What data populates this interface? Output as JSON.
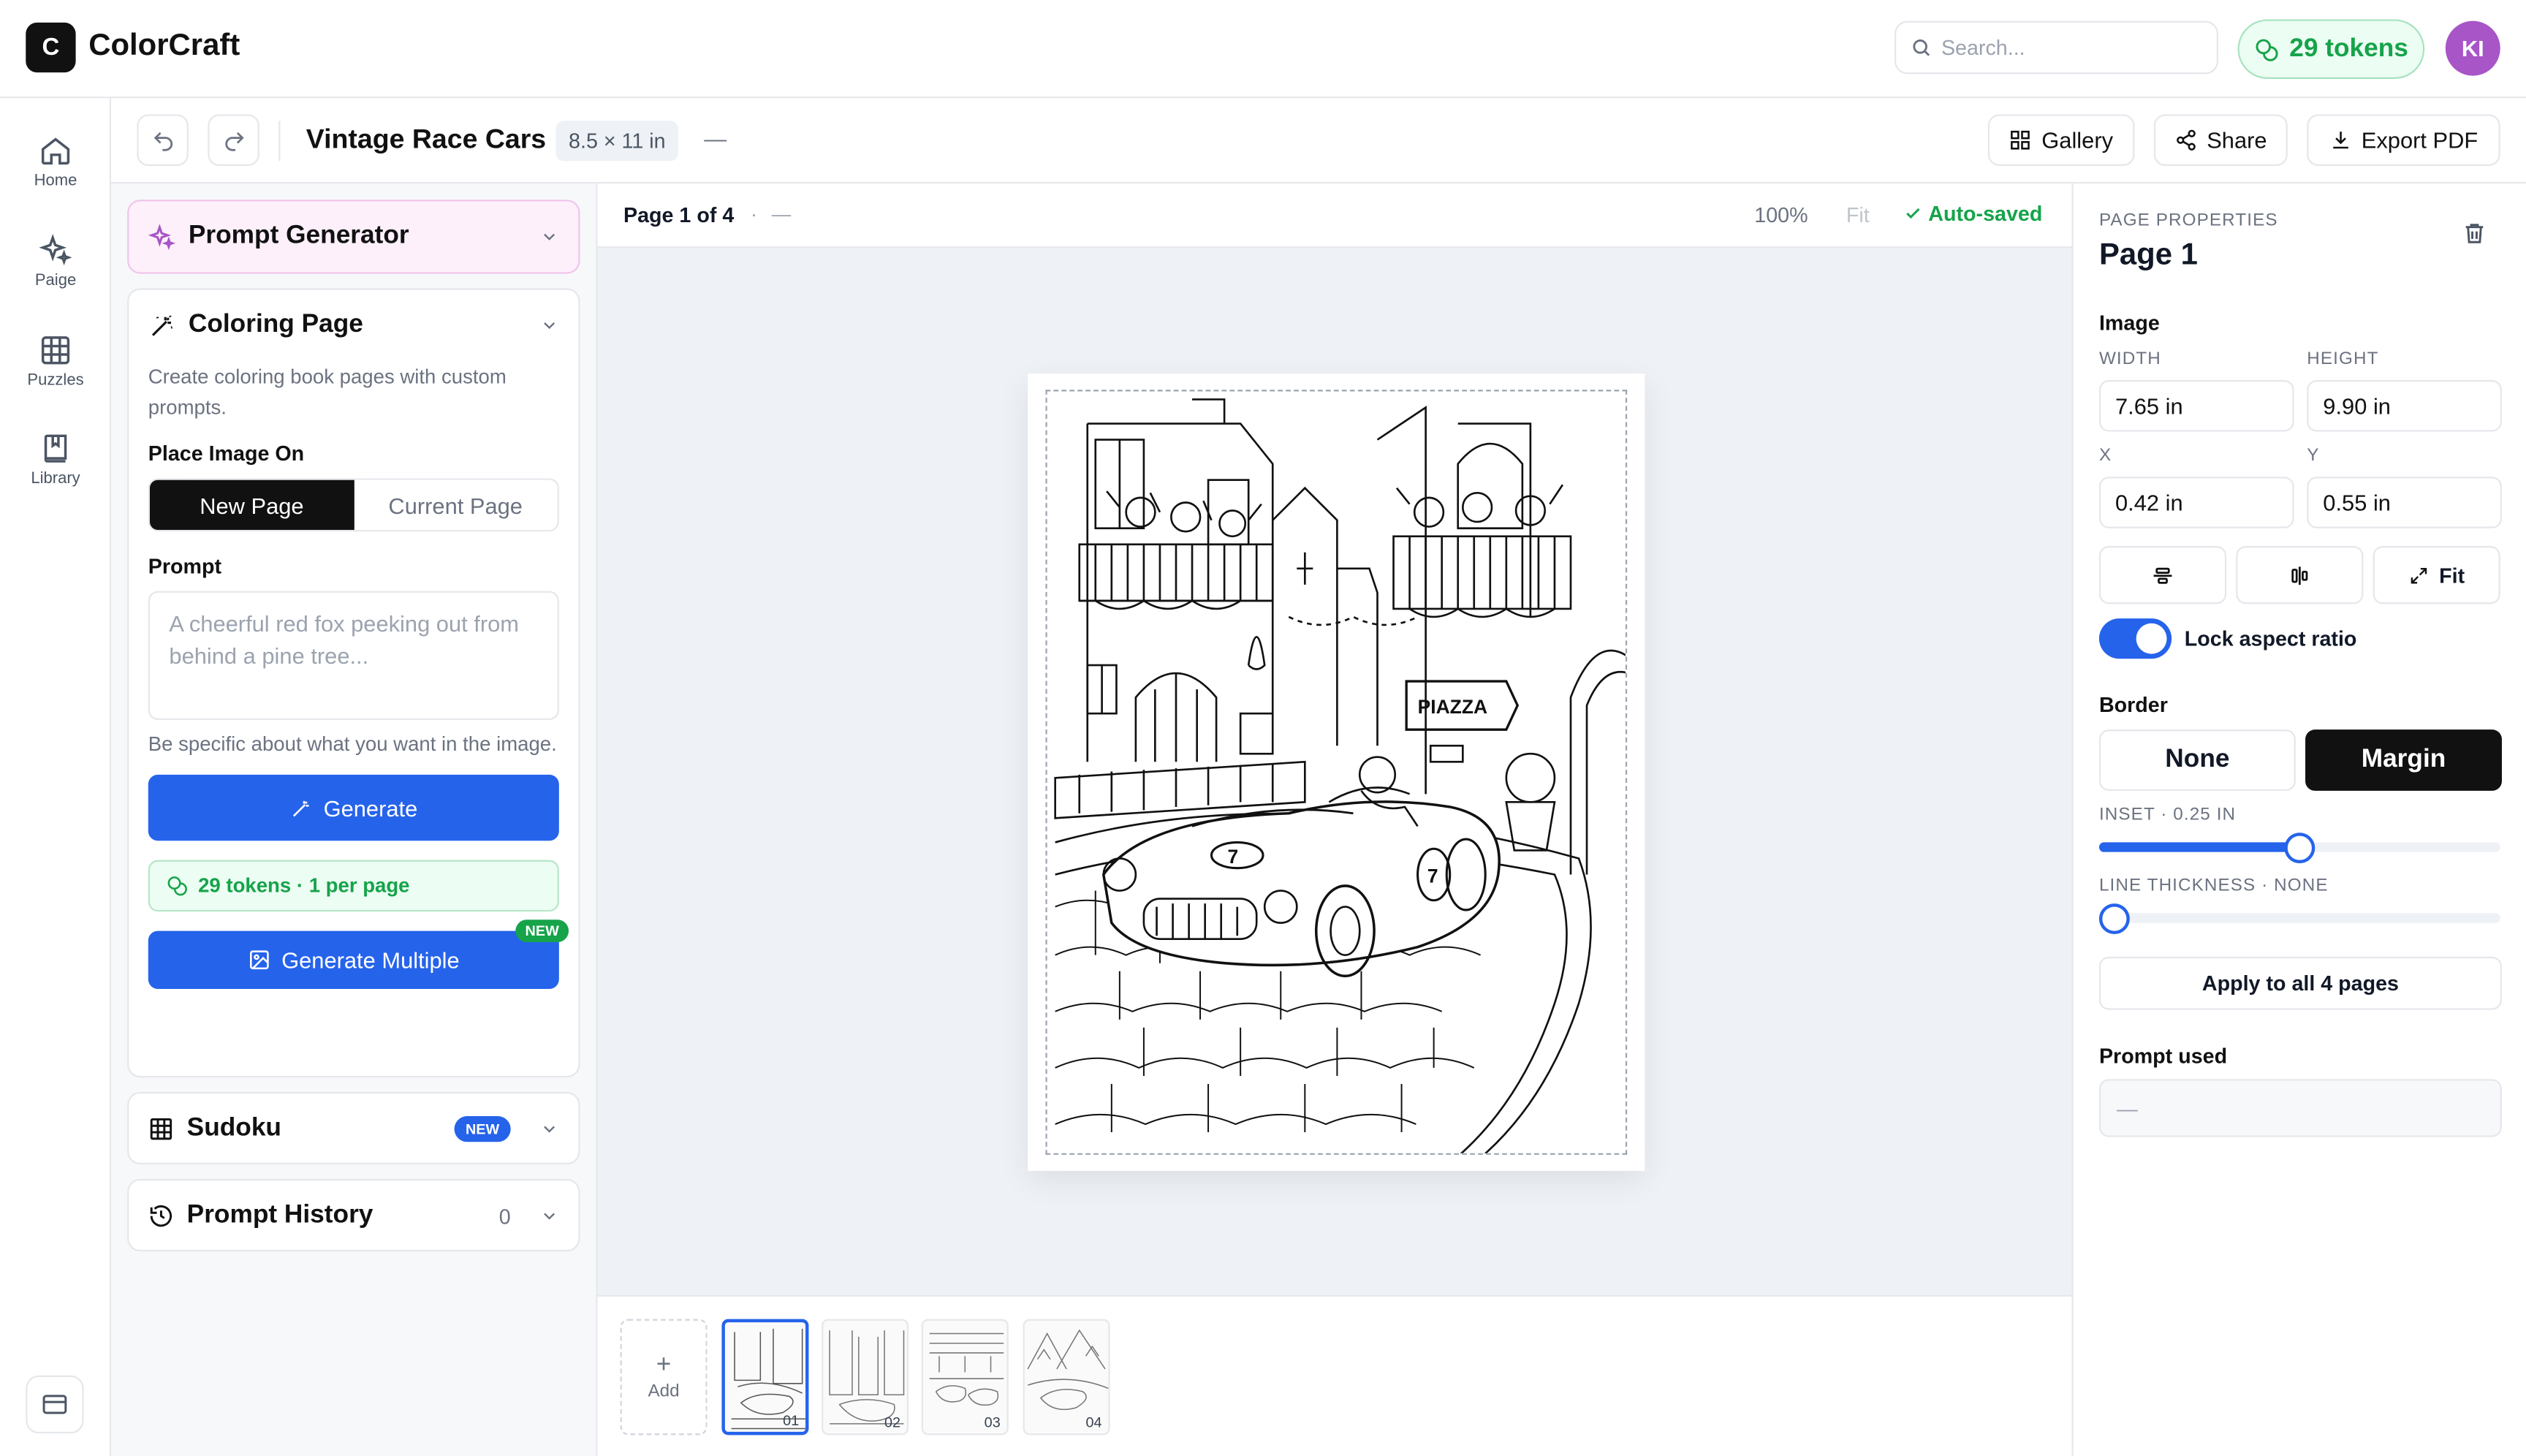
{
  "header": {
    "logo_letter": "C",
    "app_name": "ColorCraft",
    "search_placeholder": "Search...",
    "tokens": "29 tokens",
    "avatar_initials": "KI"
  },
  "rail": {
    "items": [
      {
        "label": "Home",
        "icon": "home-icon"
      },
      {
        "label": "Paige",
        "icon": "sparkle-icon"
      },
      {
        "label": "Puzzles",
        "icon": "grid-icon"
      },
      {
        "label": "Library",
        "icon": "book-icon"
      }
    ]
  },
  "toolbar": {
    "title": "Vintage Race Cars",
    "size": "8.5 × 11 in",
    "dash": "—",
    "gallery": "Gallery",
    "share": "Share",
    "export": "Export PDF"
  },
  "left": {
    "prompt_generator": "Prompt Generator",
    "coloring_page": {
      "title": "Coloring Page",
      "description": "Create coloring book pages with custom prompts.",
      "place_label": "Place Image On",
      "new_page": "New Page",
      "current_page": "Current Page",
      "prompt_label": "Prompt",
      "prompt_placeholder": "A cheerful red fox peeking out from behind a pine tree...",
      "hint": "Be specific about what you want in the image.",
      "generate": "Generate",
      "tokens_note": "29 tokens · 1 per page",
      "generate_multiple": "Generate Multiple",
      "new_badge": "NEW"
    },
    "sudoku": {
      "title": "Sudoku",
      "badge": "NEW"
    },
    "history": {
      "title": "Prompt History",
      "count": "0"
    }
  },
  "canvas": {
    "page_indicator": "Page 1 of 4",
    "dot": "·",
    "dash": "—",
    "zoom": "100%",
    "fit": "Fit",
    "saved": "Auto-saved",
    "sign_text": "PIAZZA",
    "car_number": "7",
    "add_label": "Add",
    "thumbs": [
      "01",
      "02",
      "03",
      "04"
    ]
  },
  "props": {
    "section_caption": "PAGE PROPERTIES",
    "page_title": "Page 1",
    "image_label": "Image",
    "width_label": "WIDTH",
    "height_label": "HEIGHT",
    "width": "7.65 in",
    "height": "9.90 in",
    "x_label": "X",
    "y_label": "Y",
    "x": "0.42 in",
    "y": "0.55 in",
    "fit": "Fit",
    "lock_aspect": "Lock aspect ratio",
    "lock_on": true,
    "border_label": "Border",
    "border_none": "None",
    "border_margin": "Margin",
    "inset_label": "INSET · 0.25 IN",
    "inset_fraction": 0.5,
    "thickness_label": "LINE THICKNESS · NONE",
    "thickness_fraction": 0,
    "apply_all": "Apply to all 4 pages",
    "prompt_used_label": "Prompt used",
    "prompt_used_value": "—"
  },
  "colors": {
    "accent": "#2563eb",
    "success": "#16a34a",
    "avatar": "#a855c7"
  }
}
